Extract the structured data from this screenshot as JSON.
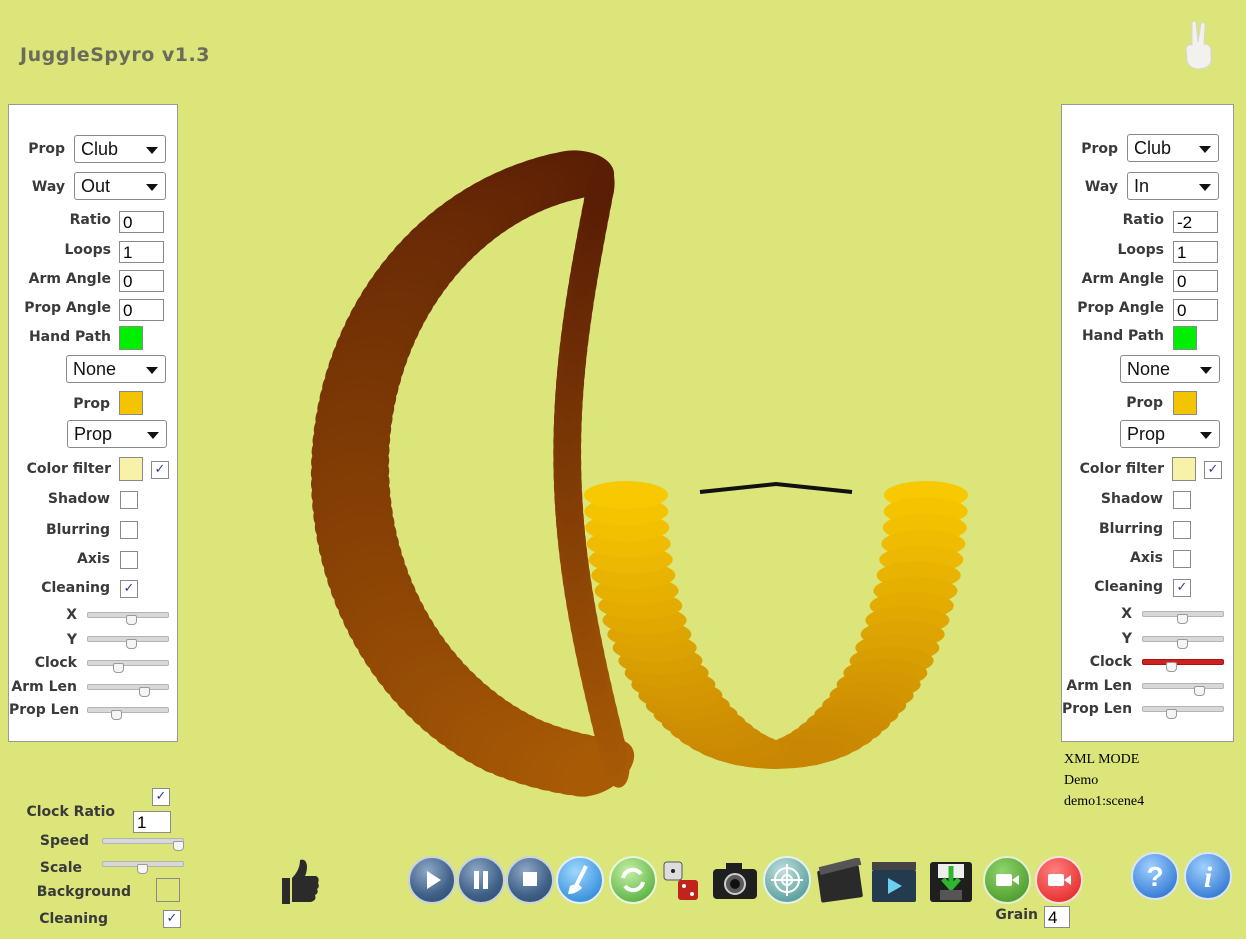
{
  "app": {
    "title": "JuggleSpyro v1.3"
  },
  "left_panel": {
    "prop_label": "Prop",
    "prop_value": "Club",
    "way_label": "Way",
    "way_value": "Out",
    "ratio_label": "Ratio",
    "ratio_value": "0",
    "loops_label": "Loops",
    "loops_value": "1",
    "arm_angle_label": "Arm Angle",
    "arm_angle_value": "0",
    "prop_angle_label": "Prop Angle",
    "prop_angle_value": "0",
    "hand_path_label": "Hand Path",
    "hand_path_color": "#00ee00",
    "hand_path_mode": "None",
    "prop_color_label": "Prop",
    "prop_color": "#f5c400",
    "prop_mode": "Prop",
    "color_filter_label": "Color filter",
    "color_filter_color": "#f8f2a8",
    "color_filter_checked": "✓",
    "shadow_label": "Shadow",
    "shadow_checked": "",
    "blurring_label": "Blurring",
    "blurring_checked": "",
    "axis_label": "Axis",
    "axis_checked": "",
    "cleaning_label": "Cleaning",
    "cleaning_checked": "✓",
    "x_label": "X",
    "y_label": "Y",
    "clock_label": "Clock",
    "arm_len_label": "Arm Len",
    "prop_len_label": "Prop Len",
    "x_level": 0.55,
    "y_level": 0.55,
    "clock_level": 0.38,
    "arm_len_level": 0.72,
    "prop_len_level": 0.35
  },
  "right_panel": {
    "prop_label": "Prop",
    "prop_value": "Club",
    "way_label": "Way",
    "way_value": "In",
    "ratio_label": "Ratio",
    "ratio_value": "-2",
    "loops_label": "Loops",
    "loops_value": "1",
    "arm_angle_label": "Arm Angle",
    "arm_angle_value": "0",
    "prop_angle_label": "Prop Angle",
    "prop_angle_value": "0",
    "hand_path_label": "Hand Path",
    "hand_path_color": "#00ee00",
    "hand_path_mode": "None",
    "prop_color_label": "Prop",
    "prop_color": "#f5c400",
    "prop_mode": "Prop",
    "color_filter_label": "Color filter",
    "color_filter_color": "#f8f2a8",
    "color_filter_checked": "✓",
    "shadow_label": "Shadow",
    "shadow_checked": "",
    "blurring_label": "Blurring",
    "blurring_checked": "",
    "axis_label": "Axis",
    "axis_checked": "",
    "cleaning_label": "Cleaning",
    "cleaning_checked": "✓",
    "x_label": "X",
    "y_label": "Y",
    "clock_label": "Clock",
    "arm_len_label": "Arm Len",
    "prop_len_label": "Prop Len",
    "x_level": 0.5,
    "y_level": 0.5,
    "clock_level": 0.35,
    "arm_len_level": 0.72,
    "prop_len_level": 0.35
  },
  "status": {
    "mode": "XML MODE",
    "name": "Demo",
    "scene": "demo1:scene4"
  },
  "bottom": {
    "clock_ratio_label": "Clock Ratio",
    "clock_ratio_checked": "✓",
    "clock_ratio_value": "1",
    "speed_label": "Speed",
    "speed_level": 0.98,
    "scale_label": "Scale",
    "scale_level": 0.5,
    "background_label": "Background",
    "background_color": "#dbe57a",
    "cleaning_label": "Cleaning",
    "cleaning_checked": "✓",
    "grain_label": "Grain",
    "grain_value": "4"
  },
  "toolbar": {
    "icons": [
      "play-icon",
      "pause-icon",
      "stop-icon",
      "broom-icon",
      "refresh-icon",
      "dice-icon",
      "camera-icon",
      "target-icon",
      "clapper-icon",
      "video-icon",
      "download-icon",
      "record-green-icon",
      "record-red-icon",
      "help-icon",
      "info-icon"
    ]
  },
  "colors": {
    "dark_club": "#5a1e05",
    "mid_club": "#a85a05",
    "light_club": "#f8c800",
    "background": "#dbe57a"
  }
}
